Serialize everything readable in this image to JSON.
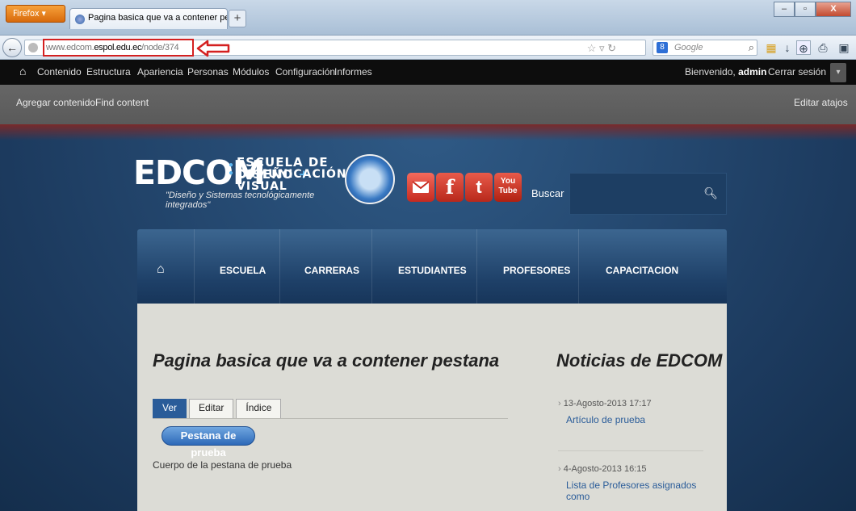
{
  "browser": {
    "firefox_button": "Firefox ▾",
    "tab_title": "Pagina basica que va a contener pestana...",
    "new_tab": "+",
    "window_controls": [
      "–",
      "▫",
      "X"
    ],
    "url_prefix": "www.edcom.",
    "url_domain": "espol.edu.ec",
    "url_path": "/node/374",
    "search_engine": "8",
    "search_placeholder": "Google",
    "url_highlight_color": "#d42020"
  },
  "admin_bar": {
    "items": [
      "Contenido",
      "Estructura",
      "Apariencia",
      "Personas",
      "Módulos",
      "Configuración",
      "Informes"
    ],
    "welcome": "Bienvenido,",
    "user": "admin",
    "logout": "Cerrar sesión"
  },
  "shortcuts": {
    "items": [
      "Agregar contenido",
      "Find content"
    ],
    "edit": "Editar atajos"
  },
  "site": {
    "logo_text": "EDCOM",
    "logo_line1": "ESCUELA DE DISEÑO",
    "logo_line1_plus": "+",
    "logo_line2": "COMUNICACIÓN VISUAL",
    "tagline": "\"Diseño y Sistemas tecnológicamente integrados\"",
    "social": [
      "mail-icon",
      "facebook-icon",
      "twitter-icon",
      "youtube-icon"
    ],
    "facebook_glyph": "f",
    "twitter_glyph": "t",
    "youtube_line1": "You",
    "youtube_line2": "Tube",
    "search_label": "Buscar",
    "nav": [
      "ESCUELA",
      "CARRERAS",
      "ESTUDIANTES",
      "PROFESORES",
      "CAPACITACION"
    ]
  },
  "content": {
    "title": "Pagina basica que va a contener pestana",
    "tabs": [
      "Ver",
      "Editar",
      "Índice"
    ],
    "pestana_button": "Pestana de prueba",
    "body": "Cuerpo de la pestana de prueba"
  },
  "sidebar": {
    "title": "Noticias de EDCOM",
    "news": [
      {
        "date": "13-Agosto-2013 17:17",
        "link": "Artículo de prueba"
      },
      {
        "date": "4-Agosto-2013 16:15",
        "link": "Lista de Profesores asignados como"
      }
    ]
  }
}
